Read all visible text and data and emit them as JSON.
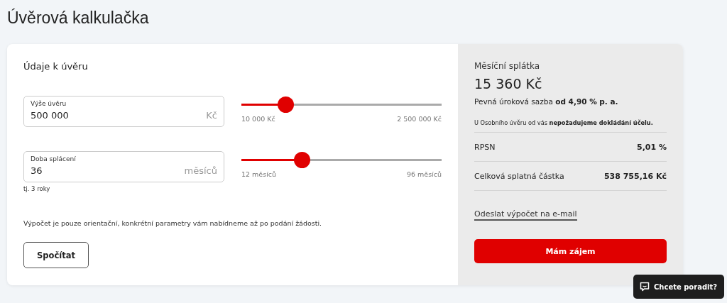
{
  "title": "Úvěrová kalkulačka",
  "form": {
    "heading": "Údaje k úvěru",
    "fields": [
      {
        "label": "Výše úvěru",
        "value": "500 000",
        "unit": "Kč",
        "level": 0.22,
        "min": "10 000 Kč",
        "max": "2 500 000 Kč"
      },
      {
        "label": "Doba splácení",
        "value": "36",
        "unit": "měsíců",
        "level": 0.3,
        "min": "12 měsíců",
        "max": "96 měsíců",
        "hint": "tj. 3 roky"
      }
    ],
    "note": "Výpočet je pouze orientační, konkrétní parametry vám nabídneme až po podání žádosti.",
    "button": "Spočítat"
  },
  "result": {
    "label": "Měsíční splátka",
    "amount": "15 360 Kč",
    "rate": "Pevná úroková sazba **od 4,90 % p. a.**",
    "info": "U Osobního úvěru od vás **nepožadujeme dokládání účelu.**",
    "rows": [
      {
        "label": "RPSN",
        "value": "5,01 %"
      },
      {
        "label": "Celková splatná částka",
        "value": "538 755,16 Kč"
      }
    ],
    "link": "Odeslat výpočet na e-mail",
    "button": "Mám zájem"
  },
  "chat": {
    "label": "Chcete poradit?"
  }
}
